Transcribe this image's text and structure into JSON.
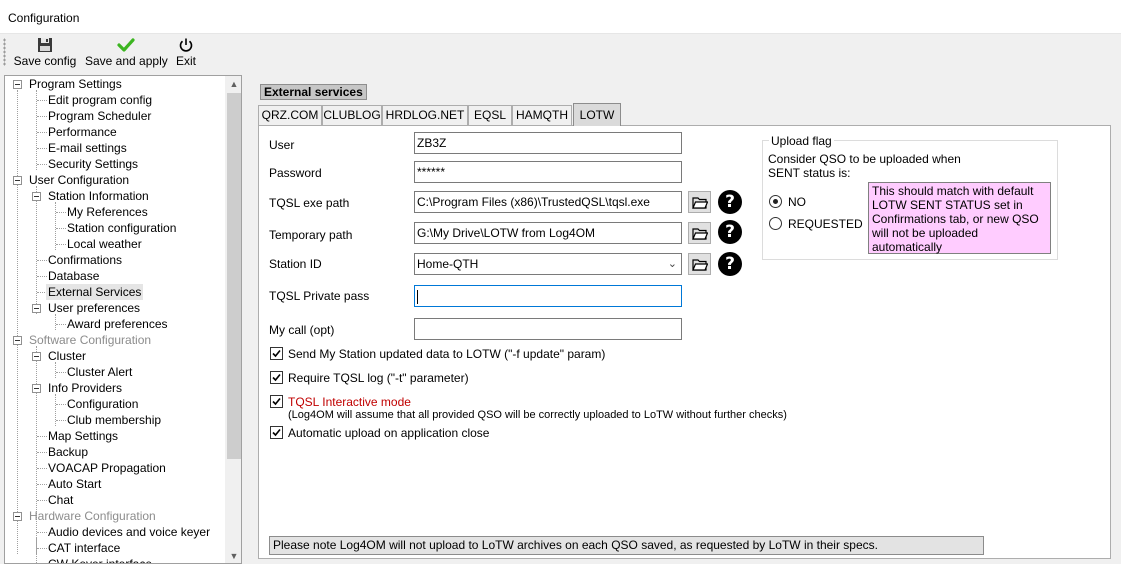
{
  "window": {
    "title": "Configuration"
  },
  "toolbar": {
    "save_config": "Save config",
    "save_apply": "Save and apply",
    "exit": "Exit"
  },
  "tree": {
    "nodes": [
      "Program Settings",
      "Edit program config",
      "Program Scheduler",
      "Performance",
      "E-mail settings",
      "Security Settings",
      "User Configuration",
      "Station Information",
      "My References",
      "Station configuration",
      "Local weather",
      "Confirmations",
      "Database",
      "External Services",
      "User preferences",
      "Award preferences",
      "Software Configuration",
      "Cluster",
      "Cluster Alert",
      "Info Providers",
      "Configuration",
      "Club membership",
      "Map Settings",
      "Backup",
      "VOACAP Propagation",
      "Auto Start",
      "Chat",
      "Hardware Configuration",
      "Audio devices and voice keyer",
      "CAT interface",
      "CW Keyer interface"
    ]
  },
  "section": {
    "title": "External services"
  },
  "tabs": [
    "QRZ.COM",
    "CLUBLOG",
    "HRDLOG.NET",
    "EQSL",
    "HAMQTH",
    "LOTW"
  ],
  "form": {
    "user_label": "User",
    "user_value": "ZB3Z",
    "password_label": "Password",
    "password_value": "******",
    "tqsl_path_label": "TQSL exe path",
    "tqsl_path_value": "C:\\Program Files (x86)\\TrustedQSL\\tqsl.exe",
    "temp_path_label": "Temporary path",
    "temp_path_value": "G:\\My Drive\\LOTW from Log4OM",
    "station_id_label": "Station ID",
    "station_id_value": "Home-QTH",
    "private_pass_label": "TQSL Private pass",
    "private_pass_value": "",
    "mycall_label": "My call (opt)",
    "mycall_value": "",
    "help_glyph": "?"
  },
  "options": {
    "send_station": "Send My Station updated data to LOTW (\"-f update\" param)",
    "require_log": "Require TQSL log (\"-t\" parameter)",
    "interactive": "TQSL Interactive mode",
    "interactive_note": "(Log4OM will assume that all provided QSO will be correctly uploaded to LoTW without further checks)",
    "auto_upload": "Automatic upload on application close"
  },
  "upload_flag": {
    "legend": "Upload flag",
    "desc_line1": "Consider QSO to be uploaded when",
    "desc_line2": "SENT status is:",
    "no": "NO",
    "requested": "REQUESTED",
    "note": "This should match with default LOTW SENT STATUS set in Confirmations tab, or new QSO will not be uploaded automatically"
  },
  "bottom_note": "Please note Log4OM will not upload to LoTW archives on each QSO saved, as requested by LoTW in their specs."
}
